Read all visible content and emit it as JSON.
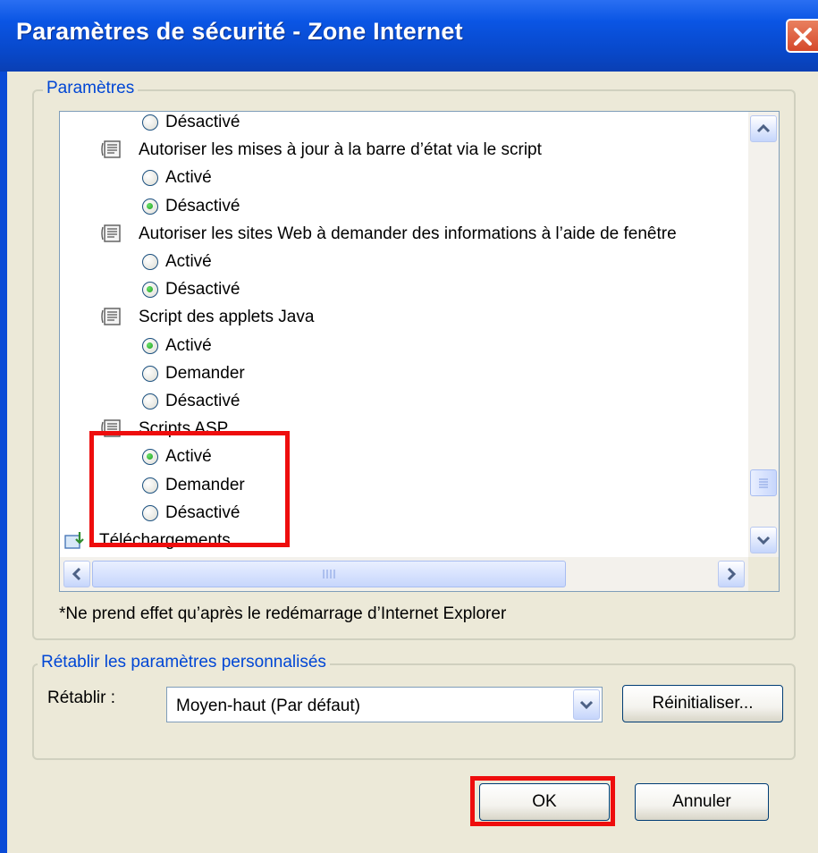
{
  "window": {
    "title": "Paramètres de sécurité - Zone Internet"
  },
  "settings_group": {
    "legend": "Paramètres"
  },
  "tree_rows": [
    {
      "kind": "option",
      "label": "Désactivé",
      "checked": false
    },
    {
      "kind": "setting",
      "label": "Autoriser les mises à jour à la barre d’état via le script"
    },
    {
      "kind": "option",
      "label": "Activé",
      "checked": false
    },
    {
      "kind": "option",
      "label": "Désactivé",
      "checked": true
    },
    {
      "kind": "setting",
      "label": "Autoriser les sites Web à demander des informations à l’aide de fenêtre"
    },
    {
      "kind": "option",
      "label": "Activé",
      "checked": false
    },
    {
      "kind": "option",
      "label": "Désactivé",
      "checked": true
    },
    {
      "kind": "setting",
      "label": "Script des applets Java"
    },
    {
      "kind": "option",
      "label": "Activé",
      "checked": true
    },
    {
      "kind": "option",
      "label": "Demander",
      "checked": false
    },
    {
      "kind": "option",
      "label": "Désactivé",
      "checked": false
    },
    {
      "kind": "setting",
      "label": "Scripts ASP"
    },
    {
      "kind": "option",
      "label": "Activé",
      "checked": true
    },
    {
      "kind": "option",
      "label": "Demander",
      "checked": false
    },
    {
      "kind": "option",
      "label": "Désactivé",
      "checked": false
    },
    {
      "kind": "category",
      "label": "Téléchargements"
    }
  ],
  "note": "*Ne prend effet qu’après le redémarrage d’Internet Explorer",
  "reset_group": {
    "legend": "Rétablir les paramètres personnalisés",
    "reset_label": "Rétablir :",
    "reset_level": "Moyen-haut (Par défaut)",
    "reset_button": "Réinitialiser..."
  },
  "buttons": {
    "ok": "OK",
    "cancel": "Annuler"
  },
  "colors": {
    "title_bar": "#0a55e4",
    "highlight": "#ee0d0d",
    "dialog_bg": "#ece9d8"
  }
}
